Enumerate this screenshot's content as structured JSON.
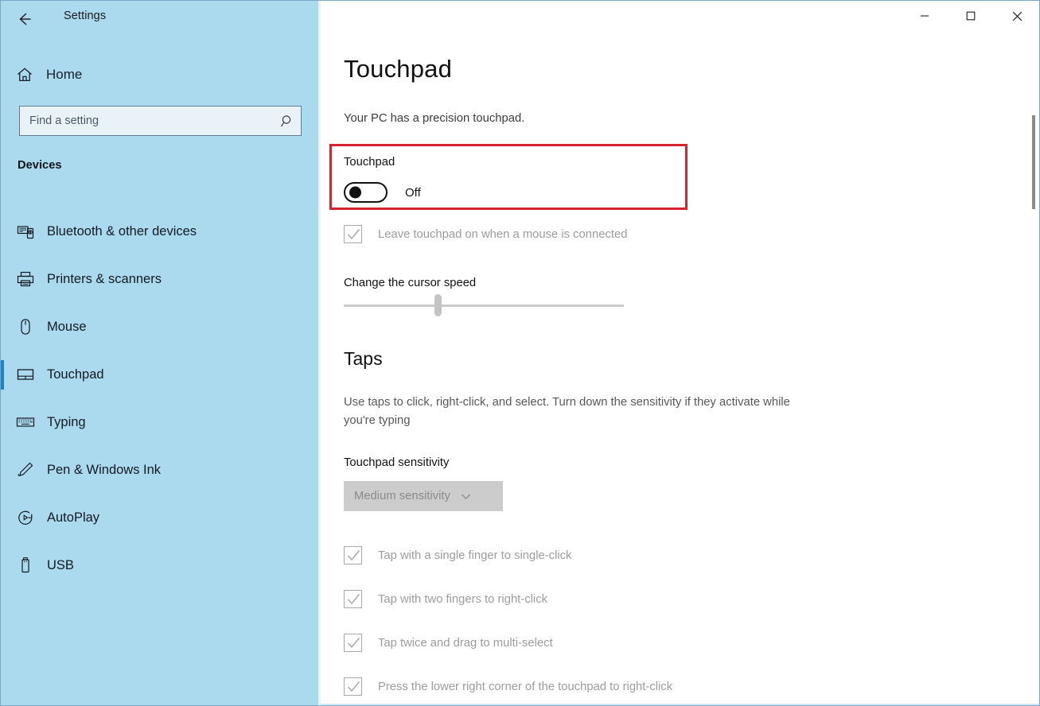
{
  "window": {
    "title": "Settings",
    "back_icon": "back-arrow-icon",
    "controls": {
      "minimize": "minimize-icon",
      "maximize": "maximize-icon",
      "close": "close-icon"
    }
  },
  "sidebar": {
    "home": {
      "label": "Home",
      "icon": "home-icon"
    },
    "search": {
      "placeholder": "Find a setting",
      "value": "",
      "icon": "search-icon"
    },
    "section_header": "Devices",
    "items": [
      {
        "label": "Bluetooth & other devices",
        "icon": "bluetooth-devices-icon",
        "selected": false
      },
      {
        "label": "Printers & scanners",
        "icon": "printer-icon",
        "selected": false
      },
      {
        "label": "Mouse",
        "icon": "mouse-icon",
        "selected": false
      },
      {
        "label": "Touchpad",
        "icon": "touchpad-icon",
        "selected": true
      },
      {
        "label": "Typing",
        "icon": "keyboard-icon",
        "selected": false
      },
      {
        "label": "Pen & Windows Ink",
        "icon": "pen-icon",
        "selected": false
      },
      {
        "label": "AutoPlay",
        "icon": "autoplay-icon",
        "selected": false
      },
      {
        "label": "USB",
        "icon": "usb-icon",
        "selected": false
      }
    ],
    "accent_color": "#1d81cc",
    "background_color": "#abd9ee"
  },
  "main": {
    "page_title": "Touchpad",
    "page_subtitle": "Your PC has a precision touchpad.",
    "highlight": {
      "color": "#d62330"
    },
    "touchpad_toggle": {
      "label": "Touchpad",
      "state": "Off",
      "checked": false
    },
    "leave_on_checkbox": {
      "label": "Leave touchpad on when a mouse is connected",
      "checked": true,
      "disabled": true
    },
    "cursor_speed": {
      "label": "Change the cursor speed",
      "value_percent": 33
    },
    "taps": {
      "heading": "Taps",
      "description": "Use taps to click, right-click, and select. Turn down the sensitivity if they activate while you're typing",
      "sensitivity_label": "Touchpad sensitivity",
      "sensitivity_value": "Medium sensitivity",
      "sensitivity_chevron": "chevron-down-icon",
      "checkboxes": [
        {
          "label": "Tap with a single finger to single-click",
          "checked": true,
          "disabled": true
        },
        {
          "label": "Tap with two fingers to right-click",
          "checked": true,
          "disabled": true
        },
        {
          "label": "Tap twice and drag to multi-select",
          "checked": true,
          "disabled": true
        },
        {
          "label": "Press the lower right corner of the touchpad to right-click",
          "checked": true,
          "disabled": true
        }
      ]
    }
  }
}
